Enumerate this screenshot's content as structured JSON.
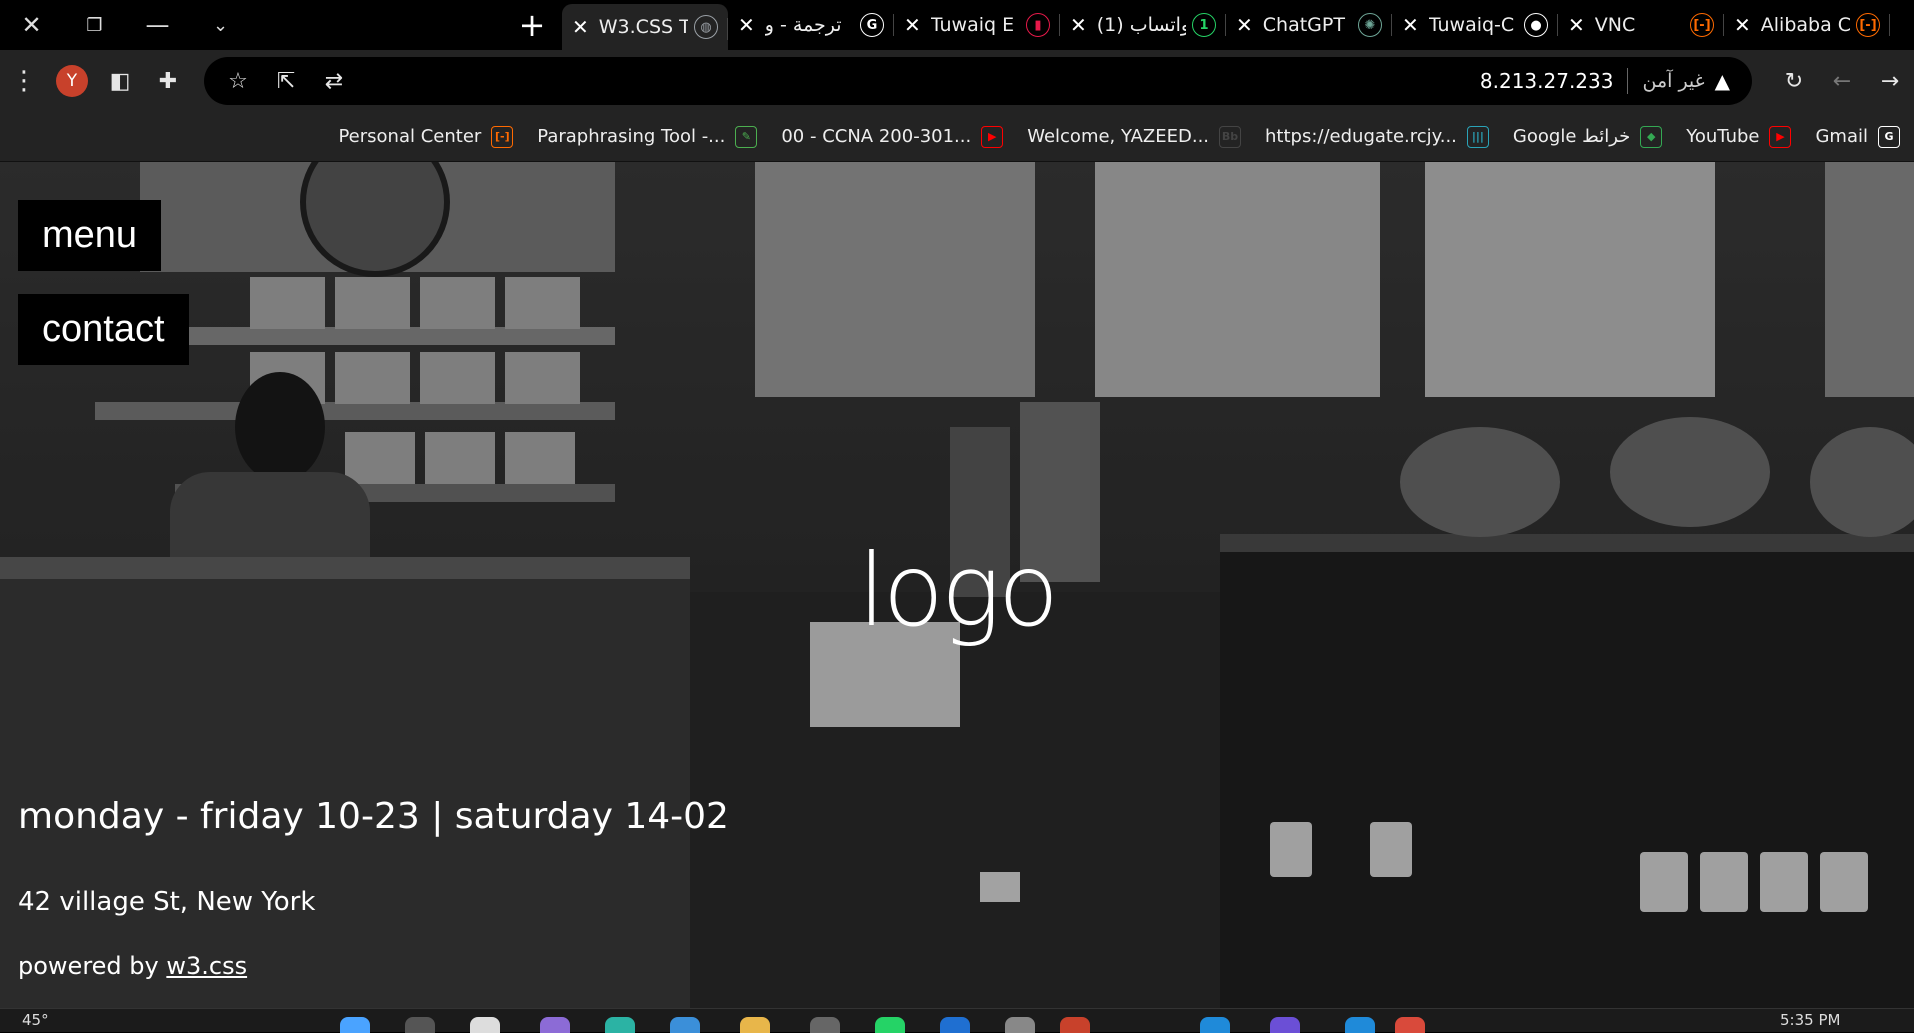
{
  "tabs": [
    {
      "title": "W3.CSS T",
      "active": true,
      "favicon": "globe-icon",
      "color": "#9aa0a6",
      "glyph": "◍"
    },
    {
      "title": "ترجمة - و",
      "active": false,
      "favicon": "google-icon",
      "color": "#ffffff",
      "glyph": "G"
    },
    {
      "title": "Tuwaiq E",
      "active": false,
      "favicon": "tuwaiq-icon",
      "color": "#e8194a",
      "glyph": "▮"
    },
    {
      "title": "(1) واتساب",
      "active": false,
      "favicon": "whatsapp-icon",
      "color": "#25d366",
      "glyph": "1"
    },
    {
      "title": "ChatGPT",
      "active": false,
      "favicon": "chatgpt-icon",
      "color": "#6ea697",
      "glyph": "✺"
    },
    {
      "title": "Tuwaiq-C",
      "active": false,
      "favicon": "github-icon",
      "color": "#ffffff",
      "glyph": "●"
    },
    {
      "title": "VNC",
      "active": false,
      "favicon": "alibaba-icon",
      "color": "#ff6a00",
      "glyph": "[-]"
    },
    {
      "title": "Alibaba C",
      "active": false,
      "favicon": "alibaba-icon",
      "color": "#ff6a00",
      "glyph": "[-]"
    }
  ],
  "toolbar": {
    "avatar_letter": "Y",
    "avatar_color": "#c8412b",
    "url": "8.213.27.233",
    "security_label": "غير آمن"
  },
  "bookmarks": [
    {
      "label": "Personal Center",
      "icon": "alibaba-icon",
      "color": "#ff6a00",
      "glyph": "[-]"
    },
    {
      "label": "Paraphrasing Tool -...",
      "icon": "quillbot-icon",
      "color": "#4caf50",
      "glyph": "✎"
    },
    {
      "label": "00 - CCNA 200-301...",
      "icon": "youtube-icon",
      "color": "#ff0000",
      "glyph": "▶"
    },
    {
      "label": "Welcome, YAZEED...",
      "icon": "blackboard-icon",
      "color": "#444444",
      "glyph": "Bb"
    },
    {
      "label": "https://edugate.rcjy...",
      "icon": "edugate-icon",
      "color": "#2aa3b8",
      "glyph": "|||"
    },
    {
      "label": "Google خرائط",
      "icon": "maps-icon",
      "color": "#34a853",
      "glyph": "◆"
    },
    {
      "label": "YouTube",
      "icon": "youtube-icon",
      "color": "#ff0000",
      "glyph": "▶"
    },
    {
      "label": "Gmail",
      "icon": "google-icon",
      "color": "#ffffff",
      "glyph": "G"
    }
  ],
  "page": {
    "menu_label": "menu",
    "contact_label": "contact",
    "logo_text": "logo",
    "hours": "monday - friday 10-23 | saturday 14-02",
    "address": "42 village St, New York",
    "powered_prefix": "powered by ",
    "powered_link": "w3.css"
  },
  "taskbar": {
    "temperature": "45°",
    "time": "5:35 PM"
  }
}
